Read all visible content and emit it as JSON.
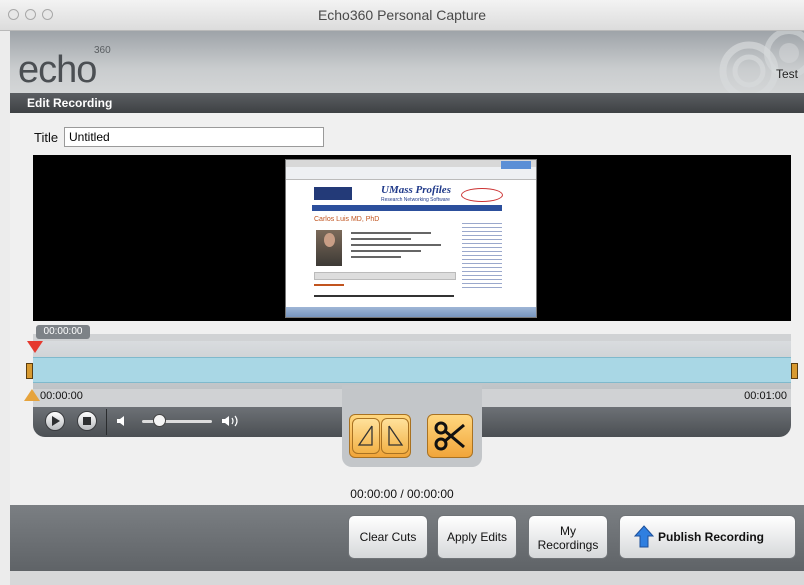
{
  "window": {
    "title": "Echo360 Personal Capture"
  },
  "brand": {
    "logo_text": "echo",
    "logo_superscript": "360",
    "user_name": "Test"
  },
  "section": {
    "title": "Edit Recording"
  },
  "recording": {
    "title_label": "Title",
    "title_value": "Untitled"
  },
  "video": {
    "thumbnail": {
      "page_heading": "UMass Profiles",
      "page_subheading": "Research Networking Software",
      "person_name": "Carlos Luis MD, PhD"
    }
  },
  "timeline": {
    "playhead_time": "00:00:00",
    "start_time": "00:00:00",
    "end_time": "00:01:00",
    "playhead_fraction": 0
  },
  "playback": {
    "volume_level": 0.25
  },
  "status": {
    "elapsed_text": "00:00:00 / 00:00:00"
  },
  "buttons": {
    "clear_cuts": "Clear Cuts",
    "apply_edits": "Apply Edits",
    "my_recordings_line1": "My",
    "my_recordings_line2": "Recordings",
    "publish_recording": "Publish Recording"
  },
  "colors": {
    "accent_orange": "#f1a53a",
    "timeline_blue": "#a9d7e5",
    "playhead_red": "#e53a2f"
  }
}
